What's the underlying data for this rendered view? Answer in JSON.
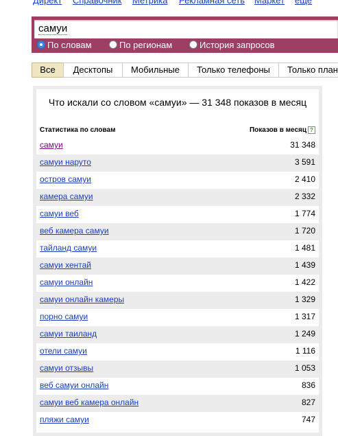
{
  "topnav": [
    "Директ",
    "Справочник",
    "Метрика",
    "Рекламная сеть",
    "Маркет",
    "еще"
  ],
  "search": {
    "query": "самуи"
  },
  "modes": [
    {
      "label": "По словам",
      "selected": true
    },
    {
      "label": "По регионам",
      "selected": false
    },
    {
      "label": "История запросов",
      "selected": false
    }
  ],
  "tabs": [
    "Все",
    "Десктопы",
    "Мобильные",
    "Только телефоны",
    "Только планшеты"
  ],
  "panel": {
    "title": "Что искали со словом «самуи» — 31 348 показов в месяц",
    "col_left": "Статистика по словам",
    "col_right": "Показов в месяц",
    "help_icon": "?",
    "rows": [
      {
        "keyword": "самуи",
        "count": "31 348"
      },
      {
        "keyword": "самуи наруто",
        "count": "3 591"
      },
      {
        "keyword": "остров самуи",
        "count": "2 410"
      },
      {
        "keyword": "камера самуи",
        "count": "2 332"
      },
      {
        "keyword": "самуи веб",
        "count": "1 774"
      },
      {
        "keyword": "веб камера самуи",
        "count": "1 720"
      },
      {
        "keyword": "тайланд самуи",
        "count": "1 481"
      },
      {
        "keyword": "самуи хентай",
        "count": "1 439"
      },
      {
        "keyword": "самуи онлайн",
        "count": "1 422"
      },
      {
        "keyword": "самуи онлайн камеры",
        "count": "1 329"
      },
      {
        "keyword": "порно самуи",
        "count": "1 317"
      },
      {
        "keyword": "самуи таиланд",
        "count": "1 249"
      },
      {
        "keyword": "отели самуи",
        "count": "1 116"
      },
      {
        "keyword": "самуи отзывы",
        "count": "1 053"
      },
      {
        "keyword": "веб самуи онлайн",
        "count": "836"
      },
      {
        "keyword": "самуи веб камера онлайн",
        "count": "827"
      },
      {
        "keyword": "пляжи самуи",
        "count": "747"
      }
    ]
  },
  "colors": {
    "accent": "#9c3f62",
    "link": "#1a3dc1",
    "visited": "#800a80",
    "tab_active": "#f0e6c2"
  }
}
